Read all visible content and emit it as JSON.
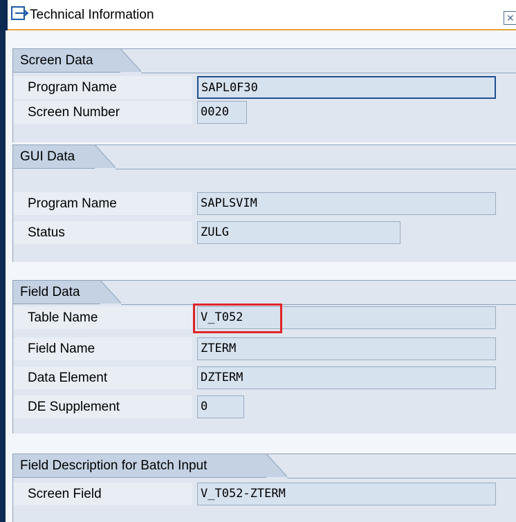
{
  "window": {
    "title": "Technical Information",
    "close_icon": "close-icon",
    "title_icon": "window-arrow-icon",
    "accent_color": "#e8a233"
  },
  "sections": {
    "screen_data": {
      "title": "Screen Data",
      "program_name_label": "Program Name",
      "program_name_value": "SAPL0F30",
      "screen_number_label": "Screen Number",
      "screen_number_value": "0020"
    },
    "gui_data": {
      "title": "GUI Data",
      "program_name_label": "Program Name",
      "program_name_value": "SAPLSVIM",
      "status_label": "Status",
      "status_value": "ZULG"
    },
    "field_data": {
      "title": "Field Data",
      "table_name_label": "Table Name",
      "table_name_value": "V_T052",
      "field_name_label": "Field Name",
      "field_name_value": "ZTERM",
      "data_element_label": "Data Element",
      "data_element_value": "DZTERM",
      "de_supplement_label": "DE Supplement",
      "de_supplement_value": "0",
      "highlight_color": "#e0242a"
    },
    "batch_input": {
      "title": "Field Description for Batch Input",
      "screen_field_label": "Screen Field",
      "screen_field_value": "V_T052-ZTERM"
    }
  }
}
